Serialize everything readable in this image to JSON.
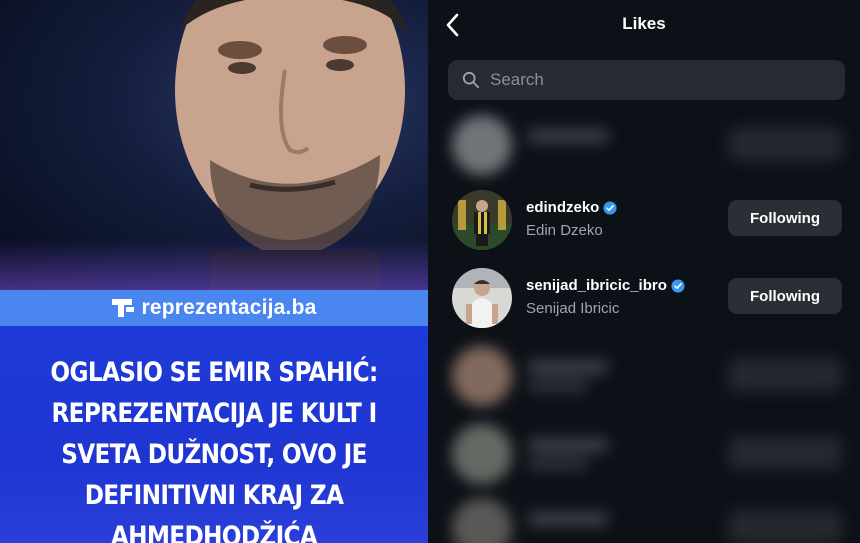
{
  "left": {
    "brand": "reprezentacija.ba",
    "headline_lines": [
      "OGLASIO SE EMIR SPAHIĆ:",
      "REPREZENTACIJA JE KULT I",
      "SVETA DUŽNOST, OVO JE",
      "DEFINITIVNI KRAJ ZA",
      "AHMEDHODŽIĆA"
    ]
  },
  "likes": {
    "title": "Likes",
    "search_placeholder": "Search",
    "users": [
      {
        "username": "edindzeko",
        "full_name": "Edin Dzeko",
        "verified": true,
        "button": "Following"
      },
      {
        "username": "senijad_ibricic_ibro",
        "full_name": "Senijad Ibricic",
        "verified": true,
        "button": "Following"
      }
    ]
  },
  "icons": {
    "back": "chevron-left-icon",
    "search": "magnifier-icon",
    "verified": "verified-badge-icon"
  },
  "colors": {
    "accent_blue": "#1f35d2",
    "banner_blue": "#4a86f0",
    "verified_blue": "#3897f0",
    "dark_bg": "#0c1117",
    "button_bg": "#2a2e35"
  }
}
